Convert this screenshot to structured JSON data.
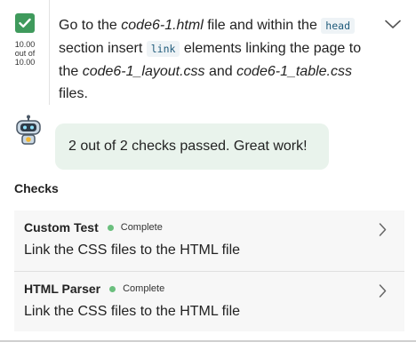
{
  "task": {
    "score_line1": "10.00",
    "score_line2": "out of",
    "score_line3": "10.00",
    "text": {
      "part1": "Go to the ",
      "file_html": "code6-1.html",
      "part2": " file and within the ",
      "code_head": "head",
      "part3": " section insert ",
      "code_link": "link",
      "part4": " elements linking the page to the ",
      "file_layout": "code6-1_layout.css",
      "part5": " and ",
      "file_table": "code6-1_table.css",
      "part6": " files."
    }
  },
  "feedback": {
    "message": "2 out of 2 checks passed. Great work!"
  },
  "checks": {
    "title": "Checks",
    "items": [
      {
        "name": "Custom Test",
        "status": "Complete",
        "description": "Link the CSS files to the HTML file"
      },
      {
        "name": "HTML Parser",
        "status": "Complete",
        "description": "Link the CSS files to the HTML file"
      }
    ]
  },
  "colors": {
    "success": "#3f9a5c",
    "status_dot": "#6bbf7e",
    "bubble_bg": "#e9f3ec"
  },
  "icons": [
    "checkmark-icon",
    "chevron-down-icon",
    "robot-icon",
    "chevron-right-icon"
  ]
}
